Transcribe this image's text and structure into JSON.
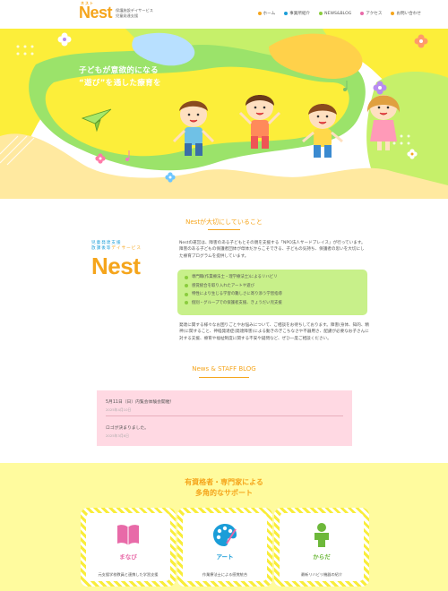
{
  "header": {
    "logo_kana": "ネスト",
    "logo_word": "Nest",
    "logo_sub_1": "保護施設デイサービス",
    "logo_sub_2": "児童発達支援",
    "nav": [
      {
        "label": "ホーム",
        "color": "#f5a51c"
      },
      {
        "label": "事業所紹介",
        "color": "#1a9dd8"
      },
      {
        "label": "NEWS&BLOG",
        "color": "#8bcc3e"
      },
      {
        "label": "アクセス",
        "color": "#e86aa8"
      },
      {
        "label": "お問い合わせ",
        "color": "#f5a51c"
      }
    ]
  },
  "hero": {
    "line1": "子どもが意欲的になる",
    "line2": "“遊び”を通した療育を"
  },
  "intro": {
    "title": "Nestが大切にしていること",
    "logo_line1": "児童発達支援",
    "logo_line2_a": "放課後等",
    "logo_line2_b": "デイサービス",
    "logo_big": "Nest",
    "paragraph": "Nestの運営は、障害のある子どもとその親を支援する「NPO法人サードプレイス」が行っています。障害のある子どもの保護者団体が母体だからこそできる、子どもの気持ち、保護者の思いを大切にした療育プログラムを提供しています。",
    "features": [
      "専門職(作業療法士・理学療法士)によるリハビリ",
      "感覚統合を取り入れたアートや遊び",
      "特性により生じる学習の難しさに寄り添う学習指導",
      "個別・グループでの保護者支援、きょうだい児支援"
    ],
    "bottom_paragraph": "発達に関する様々なお困りごとやお悩みについて、ご相談をお待ちしております。障害(身体、知的、精神)に関すること、神経発達症(発達障害)による動きのぎこちなさや不器用さ、配慮が必要なお子さんに対する支援、療育や福祉制度に関する不安や疑問など、ぜひ一度ご相談ください。"
  },
  "news": {
    "title": "News & STAFF BLOG",
    "items": [
      {
        "title": "5月11日（日）内覧会体験会開催！",
        "date": "2025年4月10日"
      },
      {
        "title": "ロゴが決まりました。",
        "date": "2025年3月6日"
      }
    ]
  },
  "support": {
    "title_line1": "有資格者・専門家による",
    "title_line2": "多角的なサポート",
    "cards": [
      {
        "label": "まなび",
        "desc": "元支援学校教員と連携した学習支援",
        "color": "#e86aa8",
        "icon": "book-icon"
      },
      {
        "label": "アート",
        "desc": "作業療法士による感覚統合",
        "color": "#1a9dd8",
        "icon": "palette-icon"
      },
      {
        "label": "からだ",
        "desc": "最新リハビリ機器の紹介",
        "color": "#6db83a",
        "icon": "person-icon"
      }
    ]
  }
}
